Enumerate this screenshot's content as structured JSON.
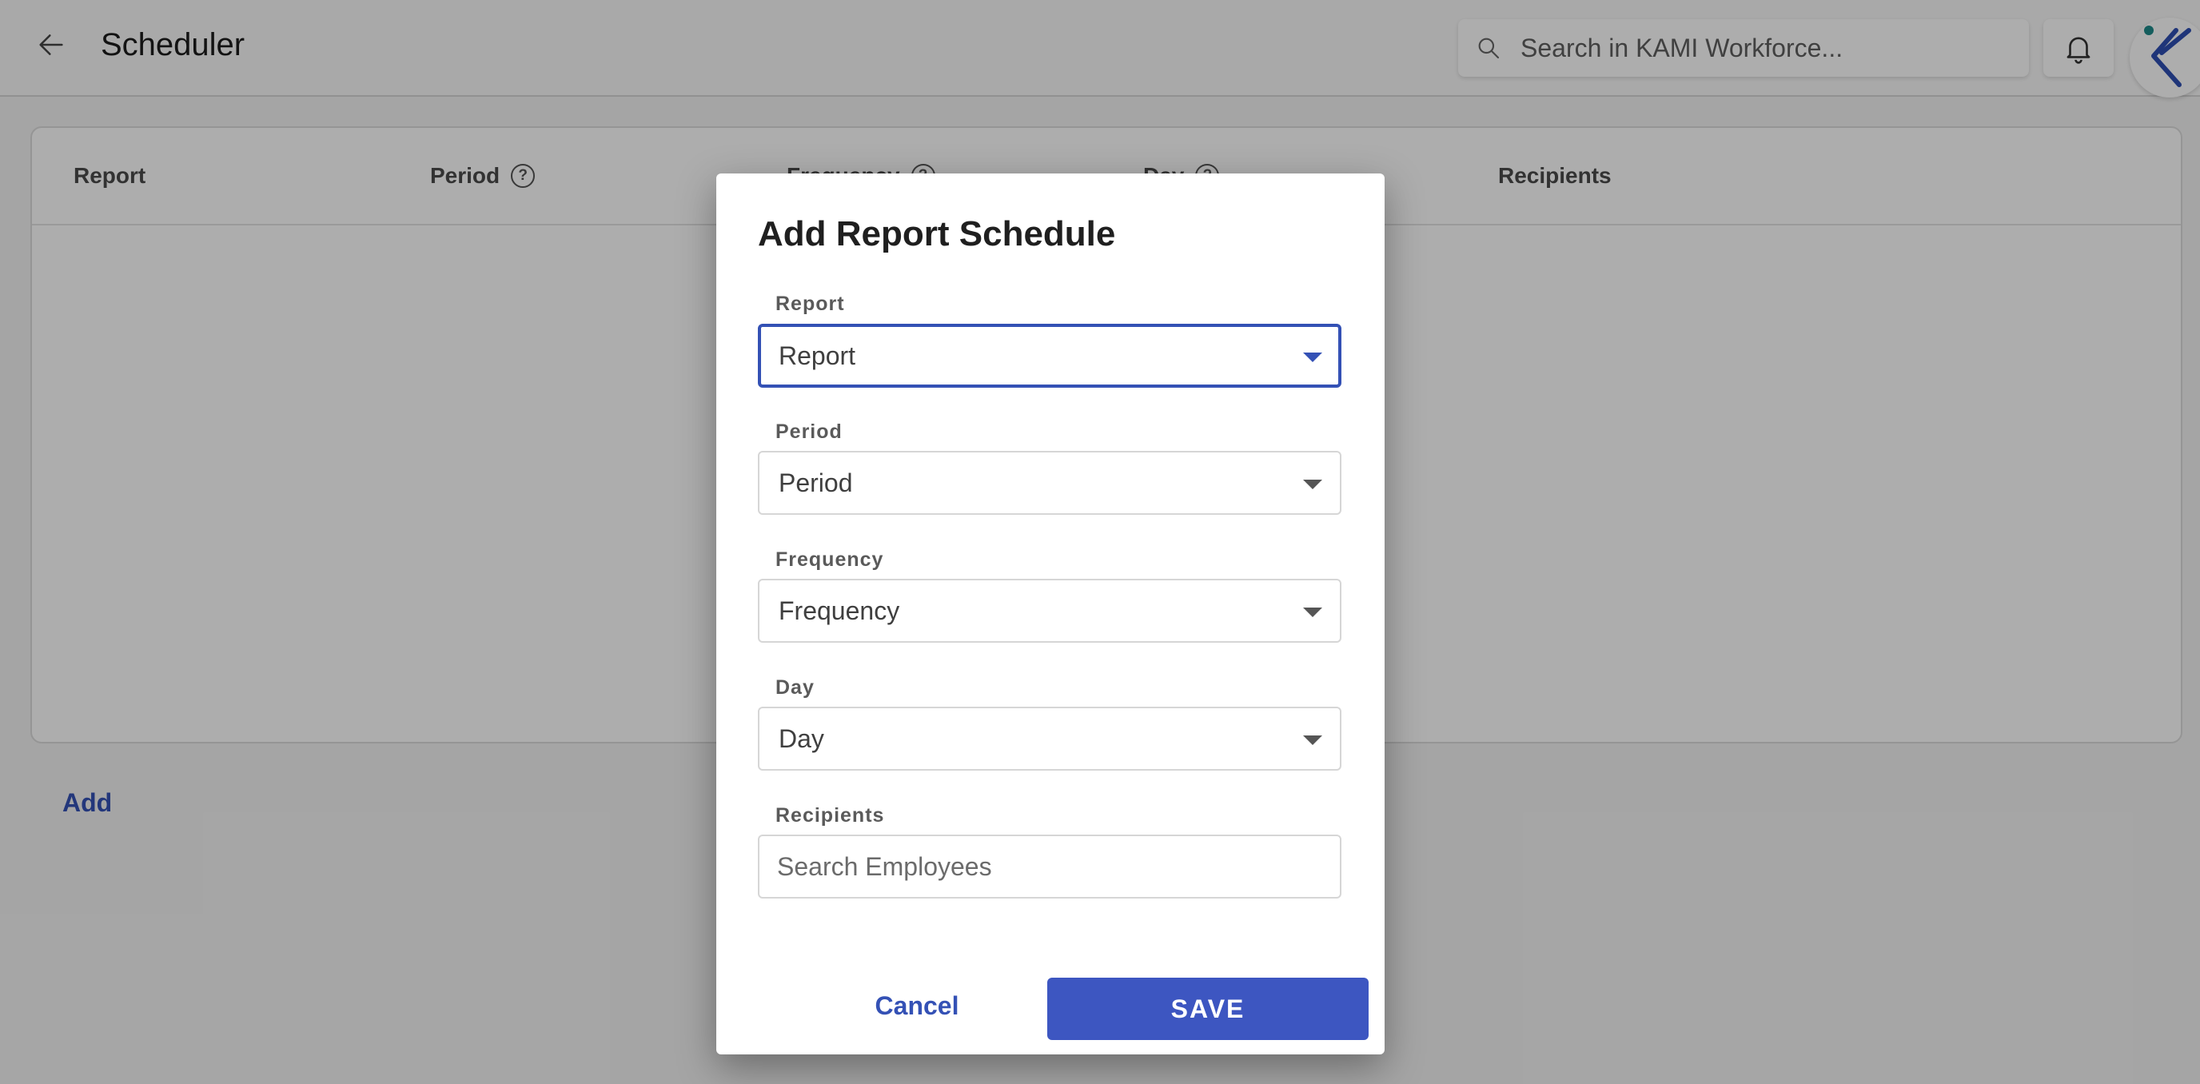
{
  "header": {
    "title": "Scheduler",
    "search_placeholder": "Search in KAMI Workforce...",
    "icons": {
      "back": "arrow-left-icon",
      "search": "search-icon",
      "notifications": "bell-icon",
      "logo": "kami-logo"
    }
  },
  "table": {
    "columns": [
      {
        "label": "Report",
        "help": false
      },
      {
        "label": "Period",
        "help": true
      },
      {
        "label": "Frequency",
        "help": true
      },
      {
        "label": "Day",
        "help": true
      },
      {
        "label": "Recipients",
        "help": false
      }
    ],
    "rows": []
  },
  "add_label": "Add",
  "dialog": {
    "title": "Add Report Schedule",
    "fields": {
      "report": {
        "label": "Report",
        "value": "Report"
      },
      "period": {
        "label": "Period",
        "value": "Period"
      },
      "frequency": {
        "label": "Frequency",
        "value": "Frequency"
      },
      "day": {
        "label": "Day",
        "value": "Day"
      },
      "recipients": {
        "label": "Recipients",
        "placeholder": "Search Employees"
      }
    },
    "cancel_label": "Cancel",
    "save_label": "SAVE"
  },
  "colors": {
    "accent": "#3451b5",
    "save_button": "#3d56c1",
    "overlay": "rgba(0,0,0,0.32)"
  }
}
